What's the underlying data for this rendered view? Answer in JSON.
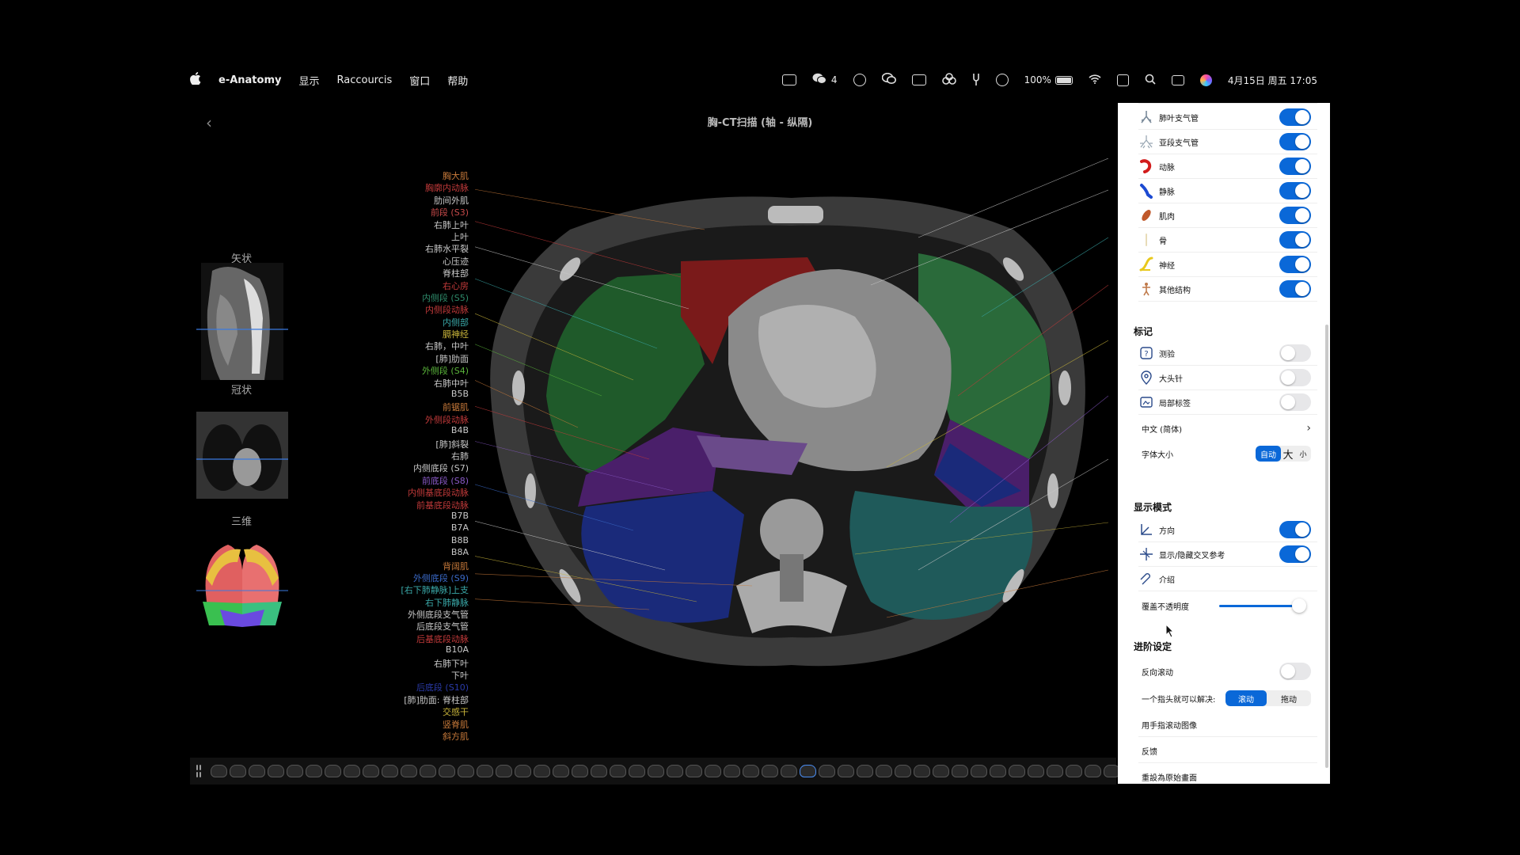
{
  "menubar": {
    "app_name": "e-Anatomy",
    "menus": [
      "显示",
      "Raccourcis",
      "窗口",
      "帮助"
    ],
    "wechat_count": "4",
    "battery": "100%",
    "datetime": "4月15日 周五  17:05"
  },
  "view": {
    "title": "胸-CT扫描 (轴 - 纵隔)",
    "thumbnails": [
      "矢状",
      "冠状",
      "三维"
    ]
  },
  "labels": [
    {
      "t": "胸大肌",
      "c": "#c87a3a"
    },
    {
      "t": "胸廓内动脉",
      "c": "#c23a3a"
    },
    {
      "t": "肋间外肌",
      "c": "#c8c8c8"
    },
    {
      "t": "前段 (S3)",
      "c": "#c84a4a"
    },
    {
      "t": "右肺上叶",
      "c": "#c8c8c8"
    },
    {
      "t": "上叶",
      "c": "#c8c8c8"
    },
    {
      "t": "右肺水平裂",
      "c": "#c8c8c8"
    },
    {
      "t": "心压迹",
      "c": "#c8c8c8"
    },
    {
      "t": "脊柱部",
      "c": "#c8c8c8"
    },
    {
      "t": "右心房",
      "c": "#c23a3a"
    },
    {
      "t": "内侧段 (S5)",
      "c": "#2e8a6a"
    },
    {
      "t": "内侧段动脉",
      "c": "#c23a3a"
    },
    {
      "t": "内侧部",
      "c": "#3aa8a8"
    },
    {
      "t": "膈神经",
      "c": "#c8b43a"
    },
    {
      "t": "右肺，中叶",
      "c": "#c8c8c8"
    },
    {
      "t": "[肺]肋面",
      "c": "#c8c8c8"
    },
    {
      "t": "外侧段 (S4)",
      "c": "#5ab43a"
    },
    {
      "t": "右肺中叶",
      "c": "#c8c8c8"
    },
    {
      "t": "B5B",
      "c": "#c8c8c8"
    },
    {
      "t": "前锯肌",
      "c": "#c87a3a"
    },
    {
      "t": "外侧段动脉",
      "c": "#c23a3a"
    },
    {
      "t": "B4B",
      "c": "#c8c8c8"
    },
    {
      "t": "[肺]斜裂",
      "c": "#c8c8c8"
    },
    {
      "t": "右肺",
      "c": "#c8c8c8"
    },
    {
      "t": "内侧底段 (S7)",
      "c": "#c8c8c8"
    },
    {
      "t": "前底段 (S8)",
      "c": "#8a5ac8"
    },
    {
      "t": "内侧基底段动脉",
      "c": "#c23a3a"
    },
    {
      "t": "前基底段动脉",
      "c": "#c23a3a"
    },
    {
      "t": "B7B",
      "c": "#c8c8c8"
    },
    {
      "t": "B7A",
      "c": "#c8c8c8"
    },
    {
      "t": "B8B",
      "c": "#c8c8c8"
    },
    {
      "t": "B8A",
      "c": "#c8c8c8"
    },
    {
      "t": "背阔肌",
      "c": "#c87a3a"
    },
    {
      "t": "外侧底段 (S9)",
      "c": "#3a6ac8"
    },
    {
      "t": "[右下肺静脉]上支",
      "c": "#3aa8a8"
    },
    {
      "t": "右下肺静脉",
      "c": "#3aa8a8"
    },
    {
      "t": "外侧底段支气管",
      "c": "#c8c8c8"
    },
    {
      "t": "后底段支气管",
      "c": "#c8c8c8"
    },
    {
      "t": "后基底段动脉",
      "c": "#c23a3a"
    },
    {
      "t": "B10A",
      "c": "#c8c8c8"
    },
    {
      "t": "右肺下叶",
      "c": "#c8c8c8"
    },
    {
      "t": "下叶",
      "c": "#c8c8c8"
    },
    {
      "t": "后底段 (S10)",
      "c": "#2a3aa8"
    },
    {
      "t": "[肺]肋面: 脊柱部",
      "c": "#c8c8c8"
    },
    {
      "t": "交感干",
      "c": "#c8b43a"
    },
    {
      "t": "竖脊肌",
      "c": "#c87a3a"
    },
    {
      "t": "斜方肌",
      "c": "#c87a3a"
    }
  ],
  "panel": {
    "layers": [
      {
        "label": "肺叶支气管",
        "on": true,
        "icon": "bronchi-icon"
      },
      {
        "label": "亚段支气管",
        "on": true,
        "icon": "subsegmental-bronchi-icon"
      },
      {
        "label": "动脉",
        "on": true,
        "icon": "artery-icon"
      },
      {
        "label": "静脉",
        "on": true,
        "icon": "vein-icon"
      },
      {
        "label": "肌肉",
        "on": true,
        "icon": "muscle-icon"
      },
      {
        "label": "骨",
        "on": true,
        "icon": "bone-icon"
      },
      {
        "label": "神经",
        "on": true,
        "icon": "nerve-icon"
      },
      {
        "label": "其他结构",
        "on": true,
        "icon": "other-structures-icon"
      }
    ],
    "markers_title": "标记",
    "markers": [
      {
        "label": "测验",
        "on": false,
        "icon": "quiz-icon"
      },
      {
        "label": "大头针",
        "on": false,
        "icon": "pin-icon"
      },
      {
        "label": "局部标签",
        "on": false,
        "icon": "local-label-icon"
      }
    ],
    "language": "中文 (简体)",
    "font_size_label": "字体大小",
    "font_size_auto": "自动",
    "font_size_big": "大",
    "font_size_small": "小",
    "display_title": "显示模式",
    "display": [
      {
        "label": "方向",
        "on": true,
        "icon": "orientation-icon"
      },
      {
        "label": "显示/隐藏交叉参考",
        "on": true,
        "icon": "crossref-icon"
      },
      {
        "label": "介绍",
        "icon": "intro-icon"
      }
    ],
    "opacity_label": "覆盖不透明度",
    "opacity_value": 0.92,
    "advanced_title": "进阶设定",
    "reverse_scroll": "反向滚动",
    "reverse_scroll_on": false,
    "one_finger": "一个指头就可以解决:",
    "one_finger_opt1": "滚动",
    "one_finger_opt2": "拖动",
    "finger_scroll": "用手指滚动图像",
    "feedback": "反馈",
    "reset": "重設為原始畫面"
  },
  "colors": {
    "accent": "#0a68d8"
  }
}
